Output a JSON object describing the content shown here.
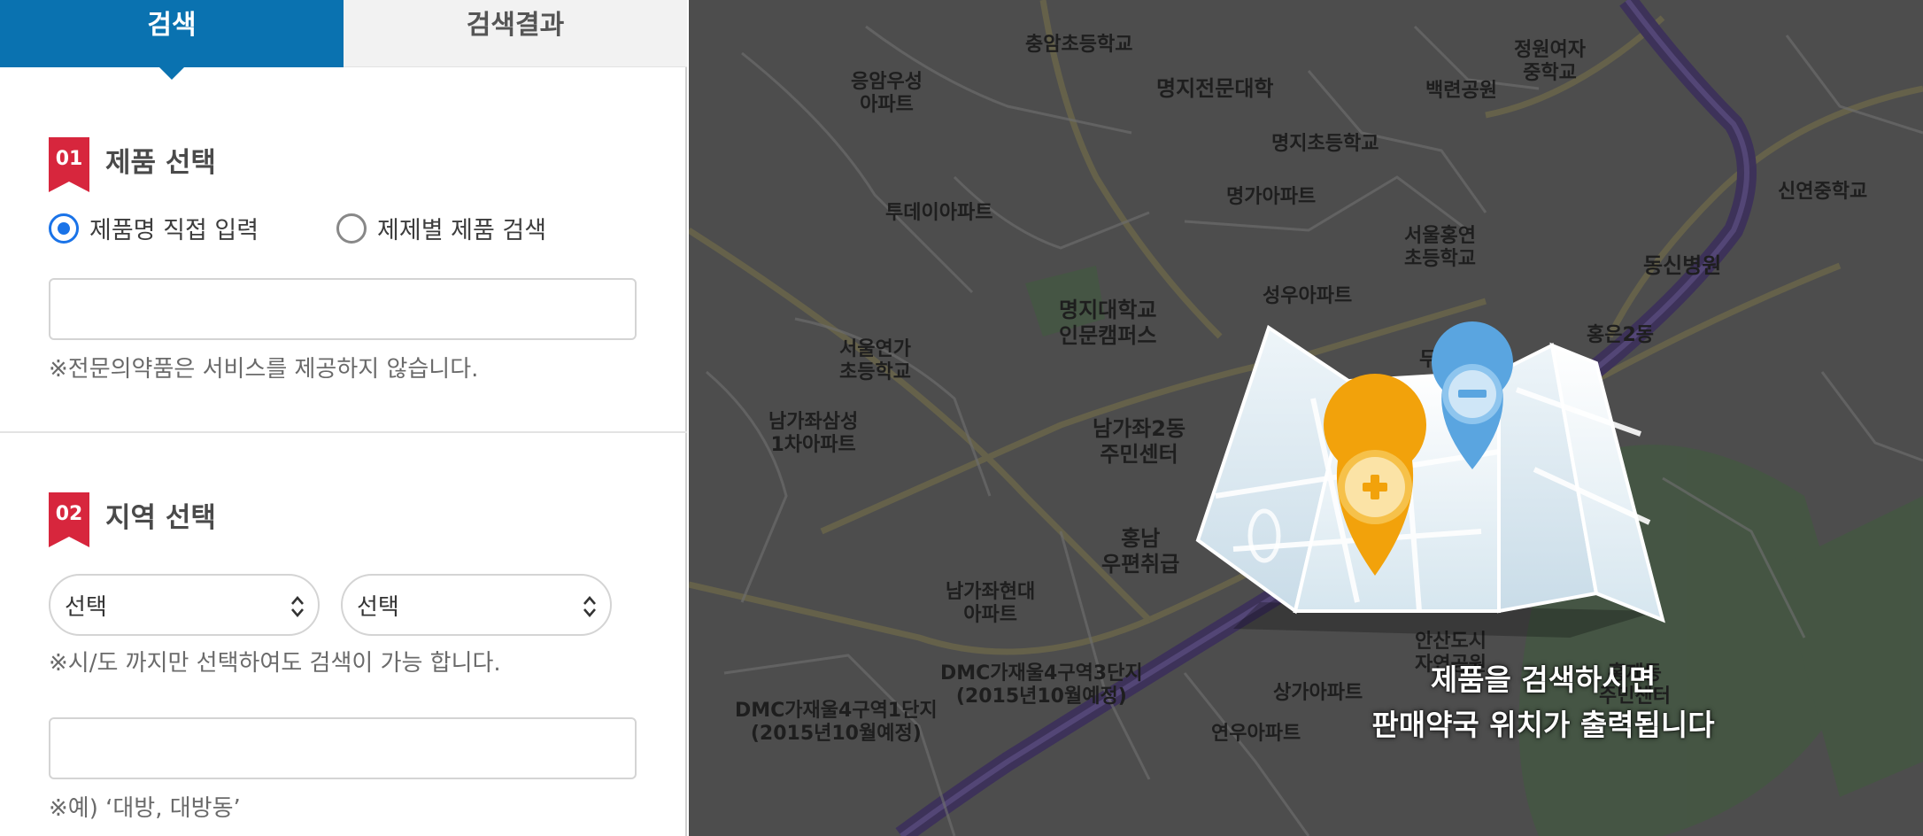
{
  "tabs": [
    {
      "label": "검색"
    },
    {
      "label": "검색결과"
    }
  ],
  "section1": {
    "number": "01",
    "title": "제품 선택",
    "radio_options": [
      {
        "label": "제품명 직접 입력",
        "selected": true
      },
      {
        "label": "제제별 제품 검색",
        "selected": false
      }
    ],
    "input_value": "",
    "note": "※전문의약품은 서비스를 제공하지 않습니다."
  },
  "section2": {
    "number": "02",
    "title": "지역 선택",
    "select1": "선택",
    "select2": "선택",
    "note1": "※시/도 까지만 선택하여도 검색이 가능 합니다.",
    "input_value": "",
    "note2": "※예) ‘대방, 대방동’"
  },
  "map": {
    "labels": [
      {
        "text": "충암초등학교"
      },
      {
        "text": "명지전문대학"
      },
      {
        "text": "응암우성\n아파트"
      },
      {
        "text": "백련공원"
      },
      {
        "text": "정원여자\n중학교"
      },
      {
        "text": "명지초등학교"
      },
      {
        "text": "신연중학교"
      },
      {
        "text": "투데이아파트"
      },
      {
        "text": "명가아파트"
      },
      {
        "text": "서울홍연\n초등학교"
      },
      {
        "text": "동신병원"
      },
      {
        "text": "명지대학교\n인문캠퍼스"
      },
      {
        "text": "성우아파트"
      },
      {
        "text": "서울연가\n초등학교"
      },
      {
        "text": "홍은2동"
      },
      {
        "text": "남가좌삼성\n1차아파트"
      },
      {
        "text": "남가좌2동\n주민센터"
      },
      {
        "text": "홍남\n우편취급"
      },
      {
        "text": "남가좌현대\n아파트"
      },
      {
        "text": "DMC가재울4구역3단지\n(2015년10월예정)"
      },
      {
        "text": "상가아파트"
      },
      {
        "text": "DMC가재울4구역1단지\n(2015년10월예정)"
      },
      {
        "text": "연우아파트"
      },
      {
        "text": "안산도시\n자연공원"
      },
      {
        "text": "홍제동\n주민센터"
      },
      {
        "text": "두산아파트"
      }
    ],
    "overlay_line1": "제품을 검색하시면",
    "overlay_line2": "판매약국 위치가 출력됩니다"
  },
  "colors": {
    "accent": "#0a72b0",
    "badge": "#d7263d",
    "radio": "#1a73e8"
  }
}
